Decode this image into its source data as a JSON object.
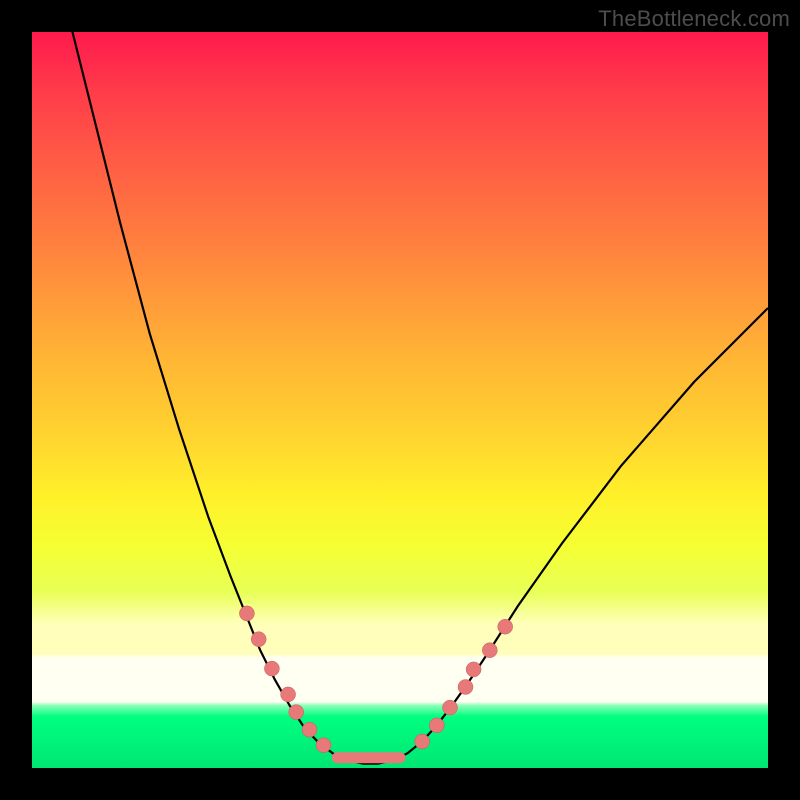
{
  "watermark": "TheBottleneck.com",
  "chart_data": {
    "type": "line",
    "title": "",
    "xlabel": "",
    "ylabel": "",
    "xlim": [
      0,
      100
    ],
    "ylim": [
      0,
      100
    ],
    "curve": [
      {
        "x": 5,
        "y": 102
      },
      {
        "x": 8,
        "y": 90
      },
      {
        "x": 12,
        "y": 74
      },
      {
        "x": 16,
        "y": 59
      },
      {
        "x": 20,
        "y": 46
      },
      {
        "x": 24,
        "y": 34
      },
      {
        "x": 27,
        "y": 26
      },
      {
        "x": 29,
        "y": 21
      },
      {
        "x": 31,
        "y": 16
      },
      {
        "x": 33,
        "y": 12
      },
      {
        "x": 35,
        "y": 8.5
      },
      {
        "x": 37,
        "y": 5.5
      },
      {
        "x": 39,
        "y": 3.4
      },
      {
        "x": 41,
        "y": 1.9
      },
      {
        "x": 43,
        "y": 1.0
      },
      {
        "x": 45,
        "y": 0.6
      },
      {
        "x": 47,
        "y": 0.6
      },
      {
        "x": 49,
        "y": 1.0
      },
      {
        "x": 51,
        "y": 2.0
      },
      {
        "x": 53,
        "y": 3.6
      },
      {
        "x": 55,
        "y": 5.8
      },
      {
        "x": 57,
        "y": 8.4
      },
      {
        "x": 59,
        "y": 11.2
      },
      {
        "x": 62,
        "y": 15.7
      },
      {
        "x": 66,
        "y": 22.0
      },
      {
        "x": 72,
        "y": 30.5
      },
      {
        "x": 80,
        "y": 41.0
      },
      {
        "x": 90,
        "y": 52.5
      },
      {
        "x": 100,
        "y": 62.5
      }
    ],
    "markers_left": [
      {
        "x": 29.2,
        "y": 21.0
      },
      {
        "x": 30.8,
        "y": 17.5
      },
      {
        "x": 32.6,
        "y": 13.5
      },
      {
        "x": 34.8,
        "y": 10.0
      },
      {
        "x": 35.9,
        "y": 7.6
      },
      {
        "x": 37.7,
        "y": 5.2
      },
      {
        "x": 39.6,
        "y": 3.1
      }
    ],
    "markers_right": [
      {
        "x": 53.0,
        "y": 3.6
      },
      {
        "x": 55.0,
        "y": 5.8
      },
      {
        "x": 56.8,
        "y": 8.2
      },
      {
        "x": 58.9,
        "y": 11.0
      },
      {
        "x": 60.0,
        "y": 13.4
      },
      {
        "x": 62.2,
        "y": 16.0
      },
      {
        "x": 64.3,
        "y": 19.2
      }
    ],
    "bottom_segment": {
      "x0": 41.5,
      "y0": 1.4,
      "x1": 50.0,
      "y1": 1.4
    },
    "marker_color": "#e77979",
    "curve_color": "#000000",
    "gradient_stops": [
      {
        "y": 100,
        "color": "#ff1a4d"
      },
      {
        "y": 55,
        "color": "#ffb734"
      },
      {
        "y": 20,
        "color": "#ffffbb"
      },
      {
        "y": 9,
        "color": "#fffff2"
      },
      {
        "y": 0,
        "color": "#00e673"
      }
    ]
  }
}
